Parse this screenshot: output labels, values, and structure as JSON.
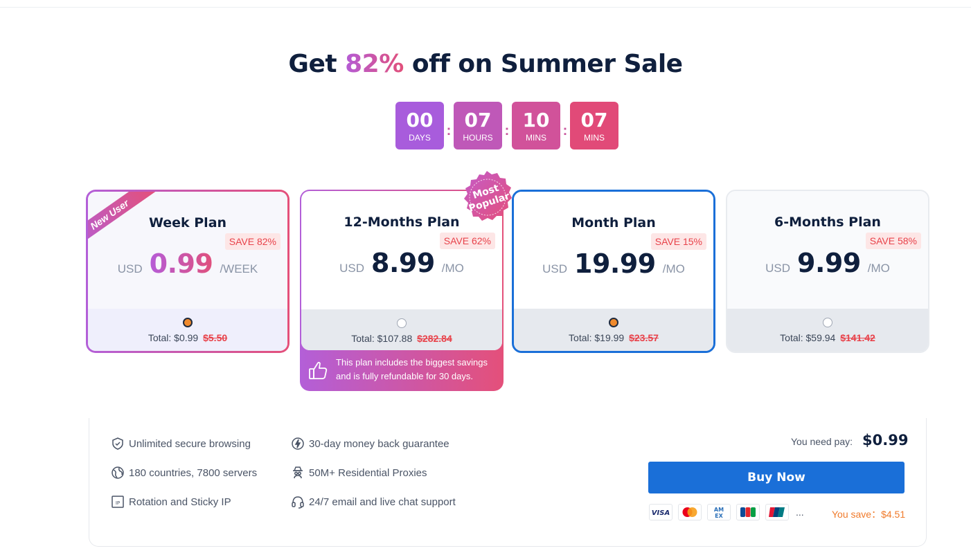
{
  "headline": {
    "prefix": "Get ",
    "accent": "82%",
    "suffix": " off on Summer Sale"
  },
  "countdown": [
    {
      "value": "00",
      "unit": "DAYS",
      "color": "#a85cdc"
    },
    {
      "value": "07",
      "unit": "HOURS",
      "color": "#bf58b8"
    },
    {
      "value": "10",
      "unit": "MINS",
      "color": "#d1529a"
    },
    {
      "value": "07",
      "unit": "MINS",
      "color": "#e14a78"
    }
  ],
  "countdown_separator": ":",
  "plans": {
    "week": {
      "ribbon": "New User",
      "name": "Week Plan",
      "save": "SAVE 82%",
      "currency": "USD",
      "price": "0.99",
      "period": "/WEEK",
      "total_label": "Total: $0.99",
      "total_old": "$5.50",
      "selected": true
    },
    "twelve": {
      "name": "12-Months Plan",
      "save": "SAVE 62%",
      "currency": "USD",
      "price": "8.99",
      "period": "/MO",
      "total_label": "Total: $107.88",
      "total_old": "$282.84",
      "selected": false,
      "seal_line1": "Most",
      "seal_line2": "Popular",
      "note_line1": "This plan includes the biggest savings",
      "note_line2": "and is fully refundable for 30 days."
    },
    "month": {
      "name": "Month Plan",
      "save": "SAVE 15%",
      "currency": "USD",
      "price": "19.99",
      "period": "/MO",
      "total_label": "Total: $19.99",
      "total_old": "$23.57",
      "selected": true
    },
    "six": {
      "name": "6-Months Plan",
      "save": "SAVE 58%",
      "currency": "USD",
      "price": "9.99",
      "period": "/MO",
      "total_label": "Total: $59.94",
      "total_old": "$141.42",
      "selected": false
    }
  },
  "features": [
    {
      "icon": "shield-icon",
      "text": "Unlimited secure browsing"
    },
    {
      "icon": "globe-icon",
      "text": "180 countries, 7800 servers"
    },
    {
      "icon": "ip-icon",
      "text": "Rotation and Sticky IP"
    },
    {
      "icon": "lightning-icon",
      "text": "30-day money back guarantee"
    },
    {
      "icon": "spy-icon",
      "text": "50M+ Residential Proxies"
    },
    {
      "icon": "headset-icon",
      "text": "24/7 email and live chat support"
    }
  ],
  "checkout": {
    "pay_label": "You need pay:",
    "pay_value": "$0.99",
    "buy_label": "Buy Now",
    "cards": [
      "VISA",
      "mastercard",
      "AMEX",
      "JCB",
      "UnionPay"
    ],
    "more": "...",
    "you_save": "You save：$4.51"
  },
  "colors": {
    "accent_blue": "#1a6fd8",
    "gradient_start": "#b35fd8",
    "gradient_end": "#e4507a",
    "save_red": "#e8424a",
    "save_orange": "#f07a2a"
  }
}
